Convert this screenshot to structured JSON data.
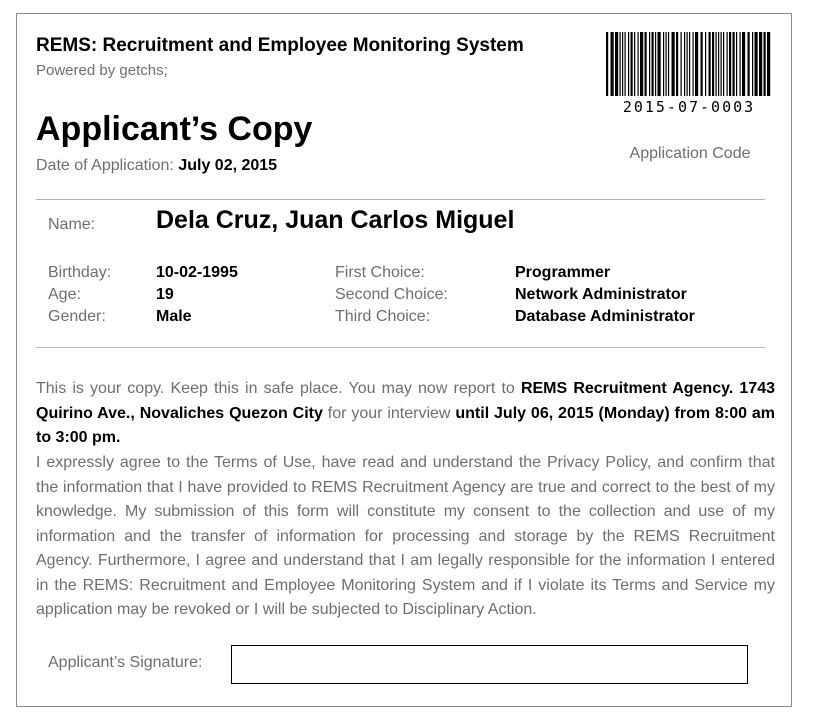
{
  "header": {
    "system_title": "REMS: Recruitment and Employee Monitoring System",
    "powered_by": "Powered by getchs;"
  },
  "barcode": {
    "icon": "barcode-icon",
    "application_code": "2015-07-0003",
    "label": "Application Code"
  },
  "copy": {
    "title": "Applicant’s Copy",
    "date_label": "Date of Application:",
    "date_value": "July 02, 2015"
  },
  "applicant": {
    "name_label": "Name:",
    "name_value": "Dela Cruz, Juan Carlos Miguel",
    "birthday_label": "Birthday:",
    "birthday_value": "10-02-1995",
    "age_label": "Age:",
    "age_value": "19",
    "gender_label": "Gender:",
    "gender_value": "Male",
    "first_choice_label": "First Choice:",
    "first_choice_value": "Programmer",
    "second_choice_label": "Second Choice:",
    "second_choice_value": "Network Administrator",
    "third_choice_label": "Third Choice:",
    "third_choice_value": "Database Administrator"
  },
  "notice": {
    "intro": "This is your copy. Keep this in safe place. You may now report to",
    "agency": "REMS Recruitment Agency.",
    "address": "1743 Quirino Ave., Novaliches Quezon City",
    "for_interview": "for your interview",
    "until": "until July 06, 2015 (Monday)",
    "time": "from 8:00 am to 3:00 pm."
  },
  "agreement": {
    "text": "I expressly agree to the Terms of Use, have read and understand the Privacy Policy, and confirm that the information that I have provided to REMS Recruitment Agency are true and correct to the best of my knowledge. My submission of this form will constitute my consent to the collection and use of my information and the transfer of information for processing and storage by the REMS Recruitment Agency. Furthermore, I agree and understand that I am legally responsible for the information I entered in the REMS: Recruitment and Employee Monitoring System and if I violate its Terms and Service my application may be revoked or I will be subjected to Disciplinary Action."
  },
  "signature": {
    "label": "Applicant’s Signature:",
    "value": ""
  }
}
